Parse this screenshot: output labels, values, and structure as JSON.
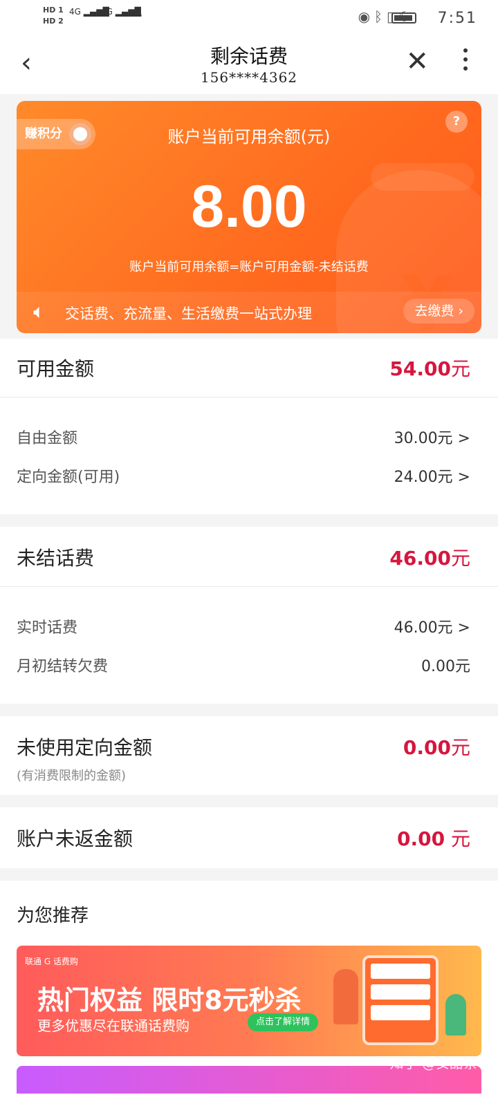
{
  "status_bar": {
    "hd1": "HD 1",
    "hd2": "HD 2",
    "net1": "4G",
    "net2": "4G",
    "time": "7:51"
  },
  "header": {
    "title": "剩余话费",
    "phone": "156****4362"
  },
  "hero": {
    "earn_points": "赚积分",
    "label": "账户当前可用余额(元)",
    "help": "?",
    "amount": "8.00",
    "formula": "账户当前可用余额=账户可用金额-未结话费",
    "notice": "交话费、充流量、生活缴费一站式办理",
    "pay_button": "去缴费 ›"
  },
  "available": {
    "label": "可用金额",
    "value": "54.00",
    "unit": "元",
    "items": [
      {
        "label": "自由金额",
        "value": "30.00元 >"
      },
      {
        "label": "定向金额(可用)",
        "value": "24.00元 >"
      }
    ]
  },
  "unsettled": {
    "label": "未结话费",
    "value": "46.00",
    "unit": "元",
    "items": [
      {
        "label": "实时话费",
        "value": "46.00元 >"
      },
      {
        "label": "月初结转欠费",
        "value": "0.00元"
      }
    ]
  },
  "unused_directed": {
    "label": "未使用定向金额",
    "note": "(有消费限制的金额)",
    "value": "0.00",
    "unit": "元"
  },
  "unreturned": {
    "label": "账户未返金额",
    "value": "0.00",
    "unit": " 元"
  },
  "recommend": {
    "title": "为您推荐",
    "banner_logos": "联通  G 话费购",
    "banner_title": "热门权益 限时8元秒杀",
    "banner_sub": "更多优惠尽在联通话费购",
    "banner_button": "点击了解详情"
  },
  "watermark": "知乎 @安甜茶"
}
